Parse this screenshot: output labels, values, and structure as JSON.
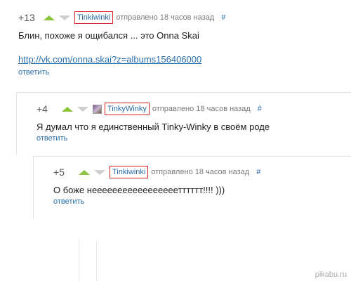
{
  "comments": [
    {
      "rating": "+13",
      "user": "Tinkiwinki",
      "time": "отправлено 18 часов назад",
      "hash": "#",
      "text": "Блин, похоже я ощибался ... это Onna Skai",
      "link": "http://vk.com/onna.skai?z=albums156406000",
      "reply": "ответить"
    },
    {
      "rating": "+4",
      "user": "TinkyWinky",
      "time": "отправлено 18 часов назад",
      "hash": "#",
      "text": "Я думал что я единственный Tinky-Winky в своём роде",
      "reply": "ответить"
    },
    {
      "rating": "+5",
      "user": "Tinkiwinki",
      "time": "отправлено 18 часов назад",
      "hash": "#",
      "text": "О боже нееееееееееееееееетттттт!!!! )))",
      "reply": "ответить"
    }
  ],
  "watermark": "pikabu.ru",
  "colors": {
    "upvote": "#8cc63f",
    "downvote": "#cfcfcf",
    "highlight_border": "#d8262a",
    "link": "#2a6ea9"
  }
}
